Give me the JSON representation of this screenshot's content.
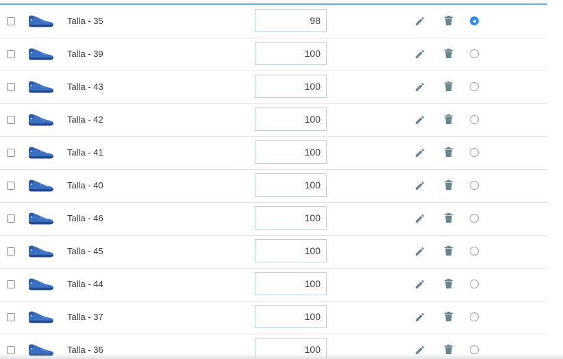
{
  "combinations": [
    {
      "label": "Talla - 35",
      "quantity": "98",
      "default": true
    },
    {
      "label": "Talla - 39",
      "quantity": "100",
      "default": false
    },
    {
      "label": "Talla - 43",
      "quantity": "100",
      "default": false
    },
    {
      "label": "Talla - 42",
      "quantity": "100",
      "default": false
    },
    {
      "label": "Talla - 41",
      "quantity": "100",
      "default": false
    },
    {
      "label": "Talla - 40",
      "quantity": "100",
      "default": false
    },
    {
      "label": "Talla - 46",
      "quantity": "100",
      "default": false
    },
    {
      "label": "Talla - 45",
      "quantity": "100",
      "default": false
    },
    {
      "label": "Talla - 44",
      "quantity": "100",
      "default": false
    },
    {
      "label": "Talla - 37",
      "quantity": "100",
      "default": false
    },
    {
      "label": "Talla - 36",
      "quantity": "100",
      "default": false
    }
  ],
  "icons": {
    "thumbnail": "shoe-thumbnail",
    "edit": "pencil-icon",
    "delete": "trash-icon"
  },
  "colors": {
    "accent_rule": "#5cb8d6",
    "radio_selected": "#2f8cf0",
    "shoe_blue": "#3a6fc4",
    "action_icon": "#6c868e"
  }
}
